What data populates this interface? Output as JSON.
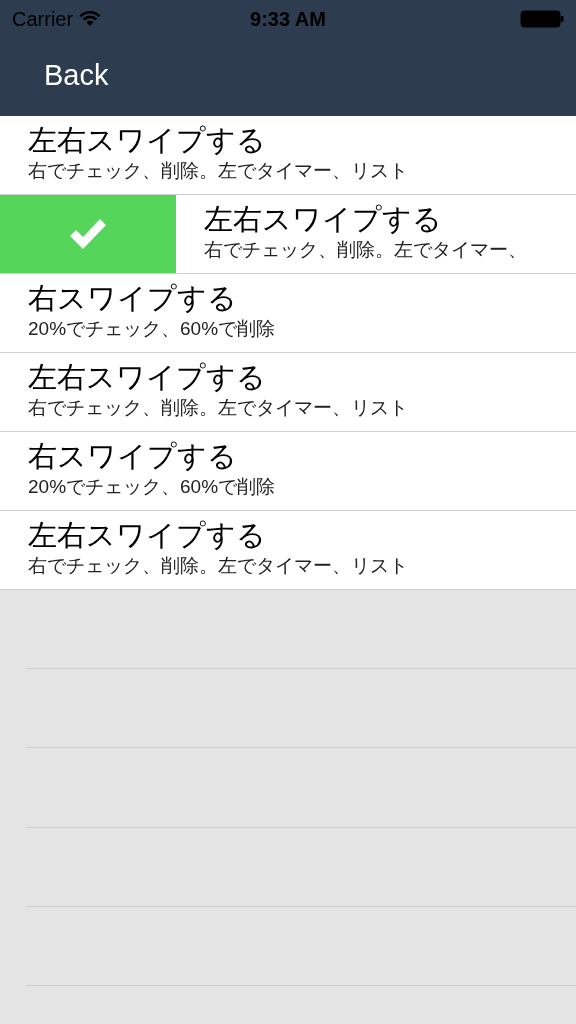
{
  "status_bar": {
    "carrier": "Carrier",
    "time": "9:33 AM"
  },
  "nav_bar": {
    "back": "Back"
  },
  "rows": [
    {
      "title": "左右スワイプする",
      "subtitle": "右でチェック、削除。左でタイマー、リスト",
      "swiped": false
    },
    {
      "title": "左右スワイプする",
      "subtitle": "右でチェック、削除。左でタイマー、",
      "swiped": true
    },
    {
      "title": "右スワイプする",
      "subtitle": "20%でチェック、60%で削除",
      "swiped": false
    },
    {
      "title": "左右スワイプする",
      "subtitle": "右でチェック、削除。左でタイマー、リスト",
      "swiped": false
    },
    {
      "title": "右スワイプする",
      "subtitle": "20%でチェック、60%で削除",
      "swiped": false
    },
    {
      "title": "左右スワイプする",
      "subtitle": "右でチェック、削除。左でタイマー、リスト",
      "swiped": false
    }
  ]
}
